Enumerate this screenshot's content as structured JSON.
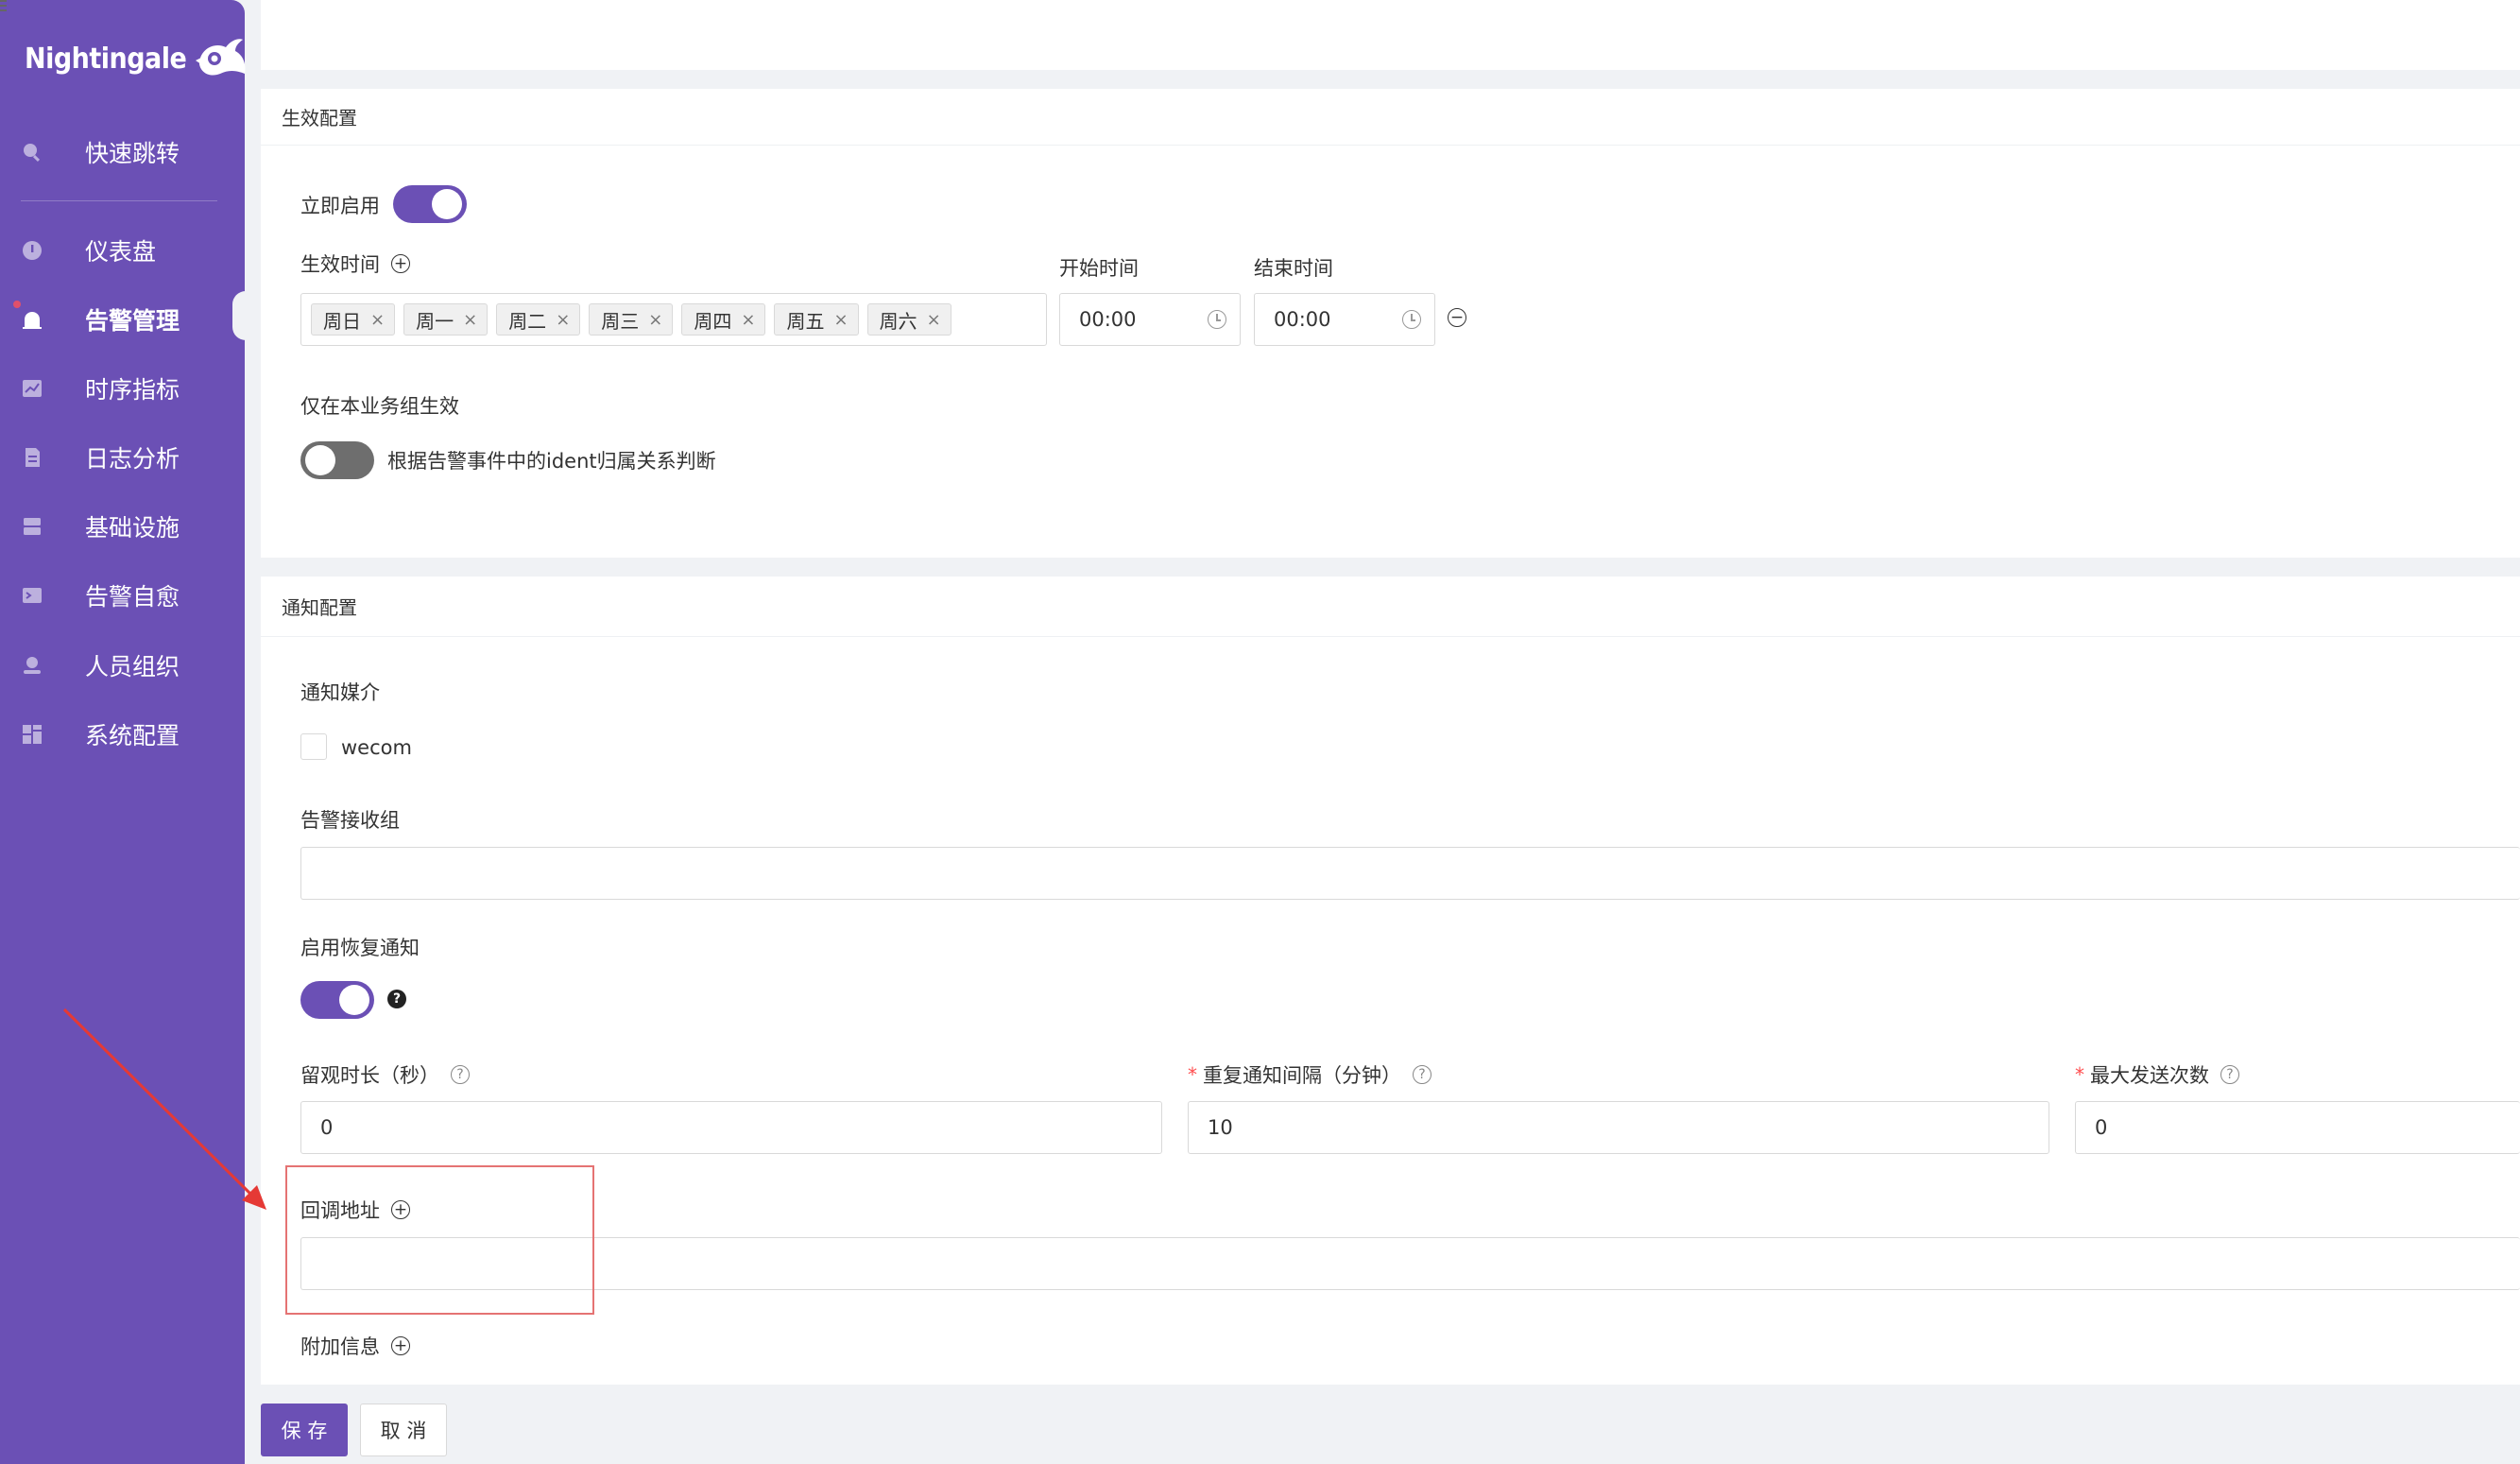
{
  "app": {
    "logo_text": "Nightingale"
  },
  "sidebar": {
    "items": [
      {
        "label": "快速跳转",
        "icon": "search-icon"
      },
      {
        "label": "仪表盘",
        "icon": "dashboard-icon"
      },
      {
        "label": "告警管理",
        "icon": "alarm-bell-icon"
      },
      {
        "label": "时序指标",
        "icon": "line-chart-icon"
      },
      {
        "label": "日志分析",
        "icon": "log-icon"
      },
      {
        "label": "基础设施",
        "icon": "server-icon"
      },
      {
        "label": "告警自愈",
        "icon": "terminal-icon"
      },
      {
        "label": "人员组织",
        "icon": "user-icon"
      },
      {
        "label": "系统配置",
        "icon": "settings-grid-icon"
      }
    ],
    "active_index": 2,
    "bg_color": "#6b50b5"
  },
  "effective": {
    "title": "生效配置",
    "enable_now_label": "立即启用",
    "enable_now": true,
    "effective_time_label": "生效时间",
    "weekdays": [
      "周日",
      "周一",
      "周二",
      "周三",
      "周四",
      "周五",
      "周六"
    ],
    "start_time_label": "开始时间",
    "start_time": "00:00",
    "end_time_label": "结束时间",
    "end_time": "00:00",
    "biz_group_label": "仅在本业务组生效",
    "biz_group_enabled": false,
    "biz_group_desc": "根据告警事件中的ident归属关系判断"
  },
  "notify": {
    "title": "通知配置",
    "channels_label": "通知媒介",
    "channels": [
      {
        "label": "wecom",
        "checked": false
      }
    ],
    "receiver_group_label": "告警接收组",
    "receiver_group_value": "",
    "recovery_label": "启用恢复通知",
    "recovery_enabled": true,
    "observe_label": "留观时长（秒）",
    "observe_value": "0",
    "repeat_label": "重复通知间隔（分钟）",
    "repeat_value": "10",
    "max_send_label": "最大发送次数",
    "max_send_value": "0",
    "callback_label": "回调地址",
    "callback_value": "",
    "extra_label": "附加信息"
  },
  "actions": {
    "save_label": "保 存",
    "cancel_label": "取 消"
  },
  "colors": {
    "primary": "#6b50b5",
    "annotation": "#e53935"
  }
}
